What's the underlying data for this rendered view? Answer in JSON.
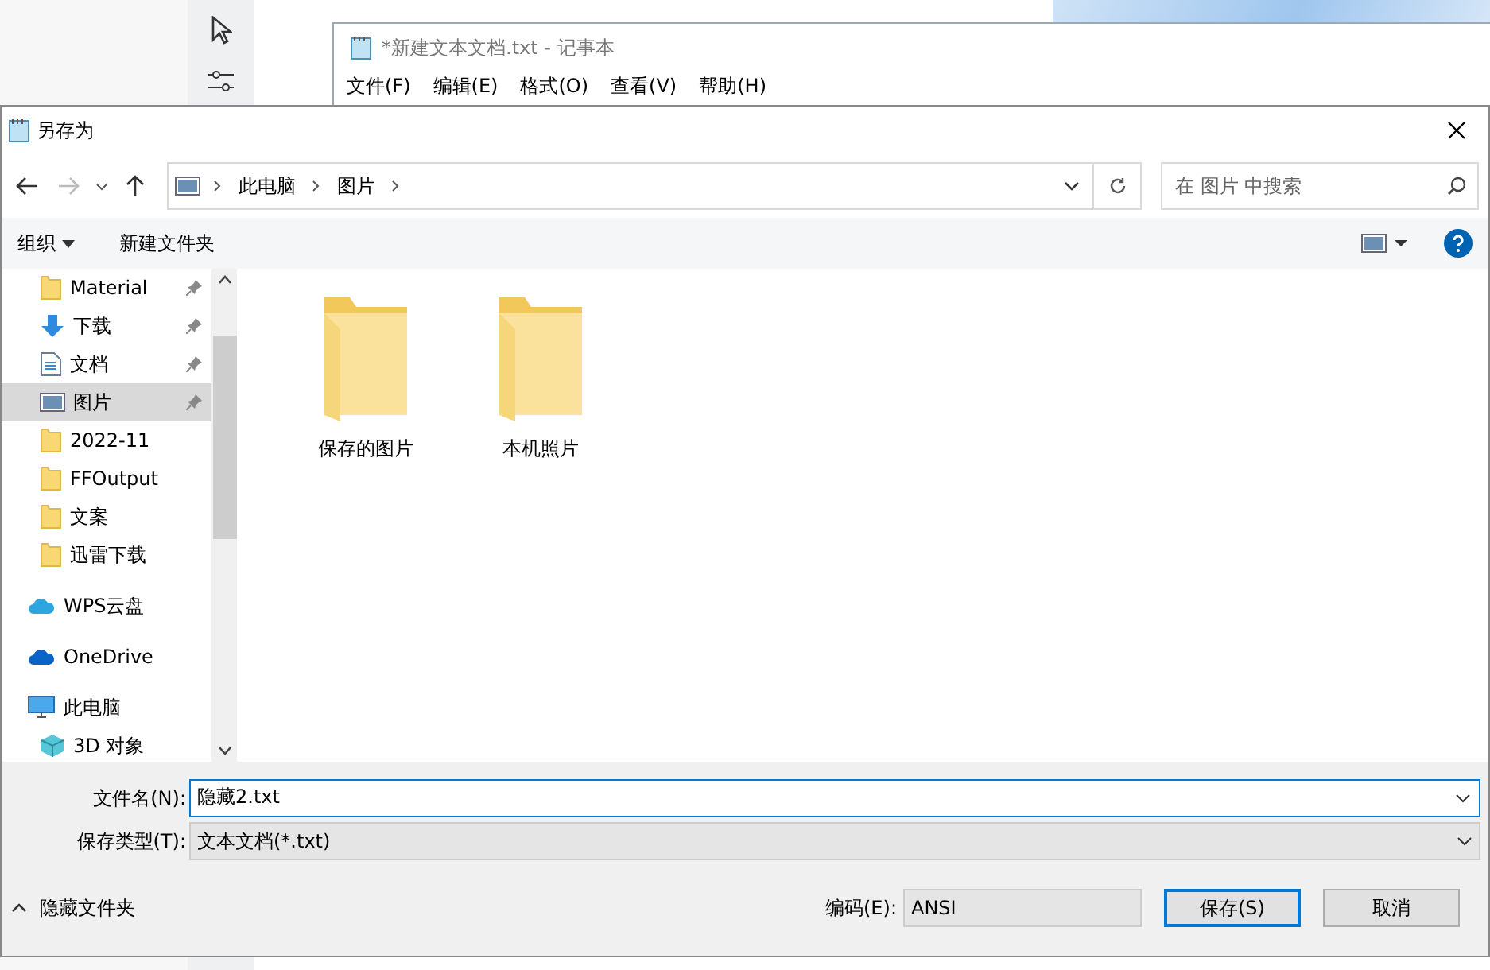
{
  "notepad": {
    "title": "*新建文本文档.txt - 记事本",
    "menu": [
      "文件(F)",
      "编辑(E)",
      "格式(O)",
      "查看(V)",
      "帮助(H)"
    ]
  },
  "dialog": {
    "title": "另存为",
    "breadcrumb": [
      "此电脑",
      "图片"
    ],
    "search": {
      "placeholder": "在 图片 中搜索"
    },
    "toolbar": {
      "organize": "组织",
      "new_folder": "新建文件夹"
    },
    "quick_access": [
      {
        "label": "Material",
        "kind": "folder",
        "pinned": true,
        "selected": false
      },
      {
        "label": "下载",
        "kind": "download",
        "pinned": true,
        "selected": false
      },
      {
        "label": "文档",
        "kind": "document",
        "pinned": true,
        "selected": false
      },
      {
        "label": "图片",
        "kind": "picture",
        "pinned": true,
        "selected": true
      },
      {
        "label": "2022-11",
        "kind": "folder",
        "pinned": false,
        "selected": false
      },
      {
        "label": "FFOutput",
        "kind": "folder",
        "pinned": false,
        "selected": false
      },
      {
        "label": "文案",
        "kind": "folder",
        "pinned": false,
        "selected": false
      },
      {
        "label": "迅雷下载",
        "kind": "folder",
        "pinned": false,
        "selected": false
      }
    ],
    "locations": [
      {
        "label": "WPS云盘",
        "kind": "cloud",
        "selected": false
      },
      {
        "label": "OneDrive",
        "kind": "onedrive",
        "selected": false
      },
      {
        "label": "此电脑",
        "kind": "pc",
        "selected": false,
        "children": [
          {
            "label": "3D 对象",
            "kind": "cube",
            "selected": false
          }
        ]
      }
    ],
    "files": [
      {
        "name": "保存的图片"
      },
      {
        "name": "本机照片"
      }
    ],
    "filename": {
      "label": "文件名(N):",
      "value": "隐藏2.txt"
    },
    "filetype": {
      "label": "保存类型(T):",
      "value": "文本文档(*.txt)"
    },
    "hide_folders": "隐藏文件夹",
    "encoding": {
      "label": "编码(E):",
      "value": "ANSI"
    },
    "buttons": [
      "保存(S)",
      "取消"
    ]
  }
}
